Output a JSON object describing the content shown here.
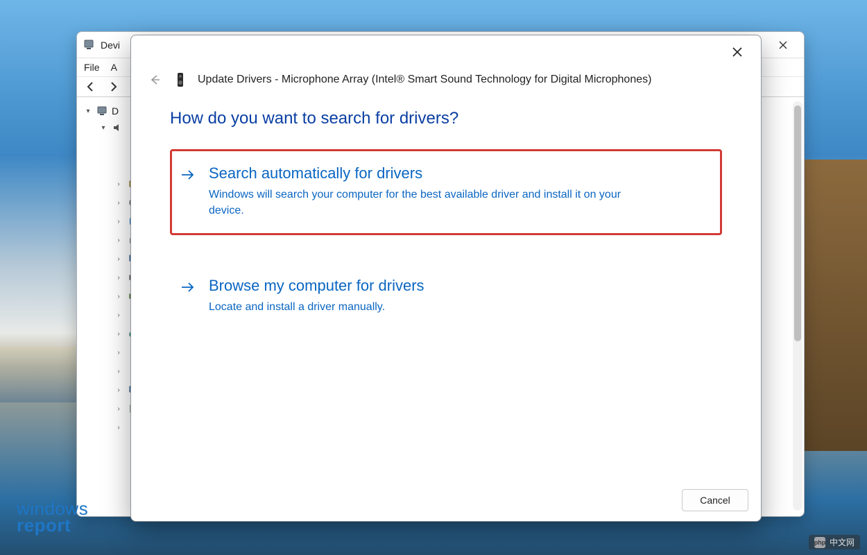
{
  "device_manager": {
    "title": "Devi",
    "menu": {
      "file": "File",
      "action": "A"
    },
    "tree": {
      "root_label": "D"
    }
  },
  "modal": {
    "title": "Update Drivers - Microphone Array (Intel® Smart Sound Technology for Digital Microphones)",
    "question": "How do you want to search for drivers?",
    "options": [
      {
        "title": "Search automatically for drivers",
        "desc": "Windows will search your computer for the best available driver and install it on your device.",
        "highlighted": true
      },
      {
        "title": "Browse my computer for drivers",
        "desc": "Locate and install a driver manually.",
        "highlighted": false
      }
    ],
    "cancel": "Cancel"
  },
  "watermark": {
    "left_line1": "windows",
    "left_line2": "report",
    "right_logo": "php",
    "right_text": "中文网"
  },
  "icons": {
    "back": "arrow-left-icon",
    "forward": "arrow-right-icon",
    "close": "close-icon",
    "speaker": "speaker-icon"
  }
}
